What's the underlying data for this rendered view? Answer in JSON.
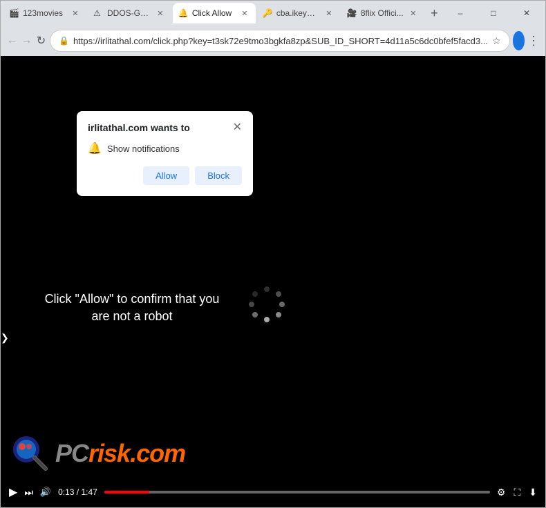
{
  "browser": {
    "tabs": [
      {
        "id": "tab1",
        "label": "123movies",
        "active": false,
        "favicon": "🎬"
      },
      {
        "id": "tab2",
        "label": "DDOS-GUA...",
        "active": false,
        "favicon": "⚠"
      },
      {
        "id": "tab3",
        "label": "Click Allow",
        "active": true,
        "favicon": "🔔"
      },
      {
        "id": "tab4",
        "label": "cba.ikeym...",
        "active": false,
        "favicon": "🔑"
      },
      {
        "id": "tab5",
        "label": "8flix Offici...",
        "active": false,
        "favicon": "🎥"
      }
    ],
    "url": "https://irlitathal.com/click.php?key=t3sk72e9tmo3bgkfa8zp&SUB_ID_SHORT=4d11a5c6dc0bfef5facd3...",
    "nav": {
      "back_disabled": true,
      "forward_disabled": true
    }
  },
  "popup": {
    "title": "irlitathal.com wants to",
    "item_text": "Show notifications",
    "allow_label": "Allow",
    "block_label": "Block"
  },
  "content": {
    "click_text": "Click \"Allow\" to confirm that you are not a robot",
    "pcrisk_text": "PC",
    "risk_text": "risk.com"
  },
  "video": {
    "current_time": "0:13",
    "total_time": "1:47"
  }
}
